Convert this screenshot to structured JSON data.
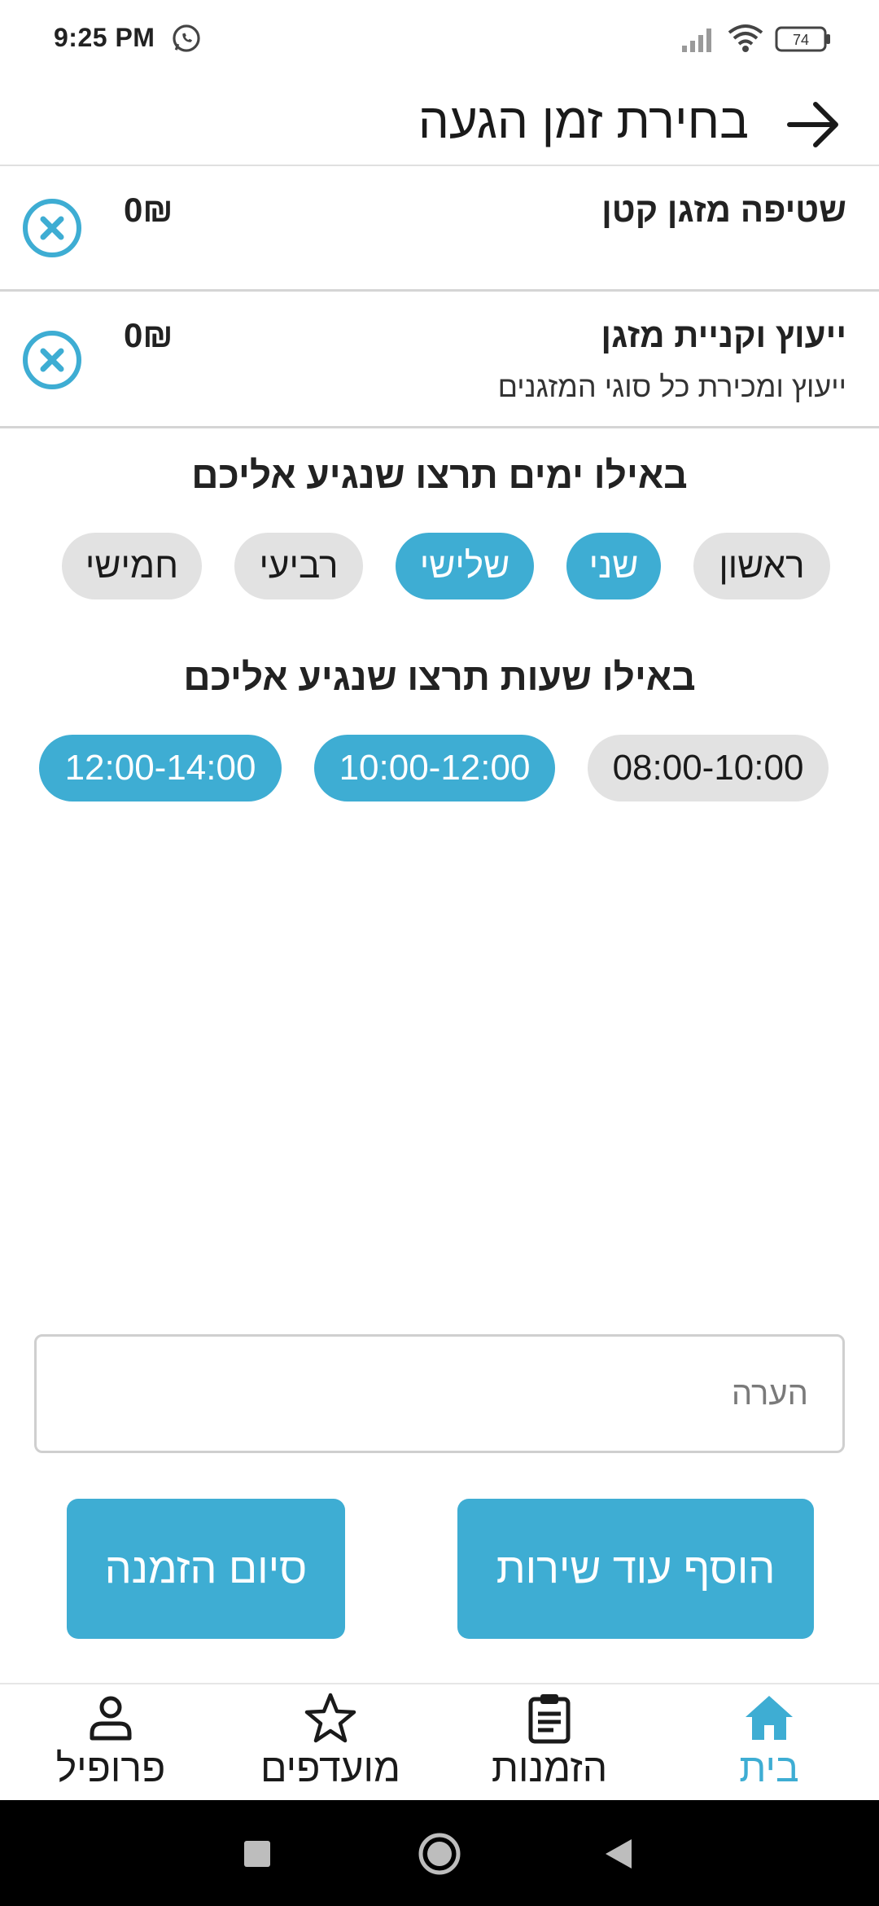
{
  "status_bar": {
    "time": "9:25 PM",
    "battery_level": "74",
    "icons": [
      "whatsapp-icon",
      "signal-icon",
      "wifi-icon",
      "battery-icon"
    ]
  },
  "header": {
    "title": "בחירת זמן הגעה",
    "back_icon": "arrow-right-icon"
  },
  "services": [
    {
      "name": "שטיפה מזגן קטן",
      "description": "",
      "price": "0₪"
    },
    {
      "name": "ייעוץ וקניית מזגן",
      "description": "ייעוץ ומכירת כל סוגי  המזגנים",
      "price": "0₪"
    }
  ],
  "days_section": {
    "title": "באילו ימים תרצו שנגיע אליכם",
    "days": [
      {
        "label": "ראשון",
        "selected": false
      },
      {
        "label": "שני",
        "selected": true
      },
      {
        "label": "שלישי",
        "selected": true
      },
      {
        "label": "רביעי",
        "selected": false
      },
      {
        "label": "חמישי",
        "selected": false
      }
    ]
  },
  "hours_section": {
    "title": "באילו שעות תרצו שנגיע אליכם",
    "slots": [
      {
        "label": "08:00-10:00",
        "selected": false
      },
      {
        "label": "10:00-12:00",
        "selected": true
      },
      {
        "label": "12:00-14:00",
        "selected": true
      }
    ]
  },
  "note": {
    "placeholder": "הערה",
    "value": ""
  },
  "actions": {
    "add_service": "הוסף עוד שירות",
    "finish_order": "סיום הזמנה"
  },
  "bottom_nav": {
    "items": [
      {
        "label": "בית",
        "icon": "home-icon",
        "active": true
      },
      {
        "label": "הזמנות",
        "icon": "clipboard-icon",
        "active": false
      },
      {
        "label": "מועדפים",
        "icon": "star-icon",
        "active": false
      },
      {
        "label": "פרופיל",
        "icon": "person-icon",
        "active": false
      }
    ]
  },
  "colors": {
    "accent": "#3eadd3",
    "chip_unselected": "#e2e2e2",
    "text": "#1a1a1a"
  }
}
